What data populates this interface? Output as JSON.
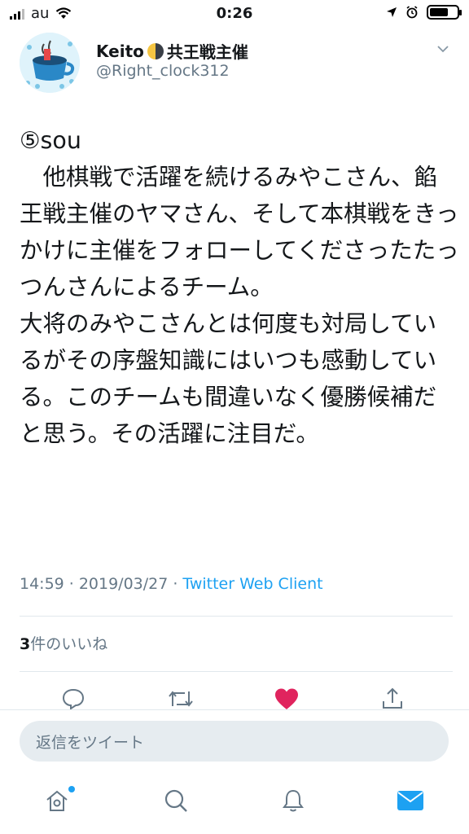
{
  "status_bar": {
    "carrier": "au",
    "time": "0:26"
  },
  "author": {
    "display_name": "Keito",
    "title_suffix": "共王戦主催",
    "handle": "@Right_clock312"
  },
  "tweet": {
    "text": "⑤sou\n　他棋戦で活躍を続けるみやこさん、餡王戦主催のヤマさん、そして本棋戦をきっかけに主催をフォローしてくださったたっつんさんによるチーム。\n大将のみやこさんとは何度も対局しているがその序盤知識にはいつも感動している。このチームも間違いなく優勝候補だと思う。その活躍に注目だ。",
    "time": "14:59",
    "date": "2019/03/27",
    "client": "Twitter Web Client",
    "sep": "·"
  },
  "likes": {
    "count": "3",
    "label": "件のいいね"
  },
  "reply": {
    "placeholder": "返信をツイート"
  },
  "colors": {
    "accent": "#1da1f2",
    "like": "#e0245e",
    "secondary": "#657786"
  },
  "icons": {
    "actions": [
      "reply-icon",
      "retweet-icon",
      "like-icon",
      "share-icon"
    ],
    "tabs": [
      "home-icon",
      "search-icon",
      "notifications-icon",
      "messages-icon"
    ]
  }
}
